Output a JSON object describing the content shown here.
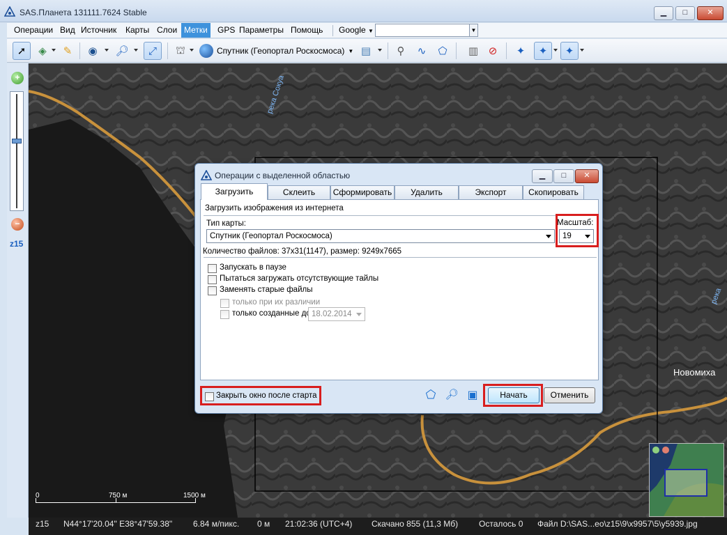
{
  "app": {
    "title": "SAS.Планета 131111.7624 Stable"
  },
  "window_controls": {
    "minimize": "▁",
    "maximize": "□",
    "close": "✕"
  },
  "menu": {
    "items": [
      "Операции",
      "Вид",
      "Источник",
      "Карты",
      "Слои",
      "Метки",
      "GPS",
      "Параметры",
      "Помощь"
    ],
    "active": "Метки",
    "search_provider": "Google",
    "search_value": ""
  },
  "toolbar": {
    "map_source_label": "Спутник (Геопортал Роскосмоса)"
  },
  "zoom": {
    "level_label": "z15",
    "level_fraction": 0.42
  },
  "map": {
    "labels": {
      "river": "река Сокуа",
      "town": "Новомиха",
      "river_right": "река"
    },
    "scale": {
      "tick0": "0",
      "tick1": "750 м",
      "tick2": "1500 м"
    }
  },
  "status": {
    "zoom": "z15",
    "coords": "N44°17'20.04\" E38°47'59.38\"",
    "resolution": "6.84 м/пикс.",
    "distance": "0 м",
    "time": "21:02:36 (UTC+4)",
    "downloaded": "Скачано 855 (11,3 Мб)",
    "remaining": "Осталось 0",
    "file": "Файл D:\\SAS...eo\\z15\\9\\x9957\\5\\y5939.jpg"
  },
  "dialog": {
    "title": "Операции с выделенной областью",
    "tabs": [
      "Загрузить",
      "Склеить",
      "Сформировать",
      "Удалить",
      "Экспорт",
      "Скопировать"
    ],
    "active_tab": "Загрузить",
    "header": "Загрузить изображения из интернета",
    "map_type_label": "Тип карты:",
    "map_type_value": "Спутник (Геопортал Роскосмоса)",
    "scale_label": "Масштаб:",
    "scale_value": "19",
    "files_info": "Количество файлов: 37x31(1147), размер: 9249x7665",
    "options": {
      "start_paused": "Запускать в паузе",
      "try_missing": "Пытаться загружать отсутствующие тайлы",
      "replace_old": "Заменять старые файлы",
      "only_diff": "только при их различии",
      "only_created_before": "только созданные до",
      "date_value": "18.02.2014"
    },
    "close_after_start": "Закрыть окно после старта",
    "start_button": "Начать",
    "cancel_button": "Отменить"
  },
  "colors": {
    "accent": "#3e92dc",
    "highlight": "#d81e1e",
    "road": "#c8913c"
  }
}
